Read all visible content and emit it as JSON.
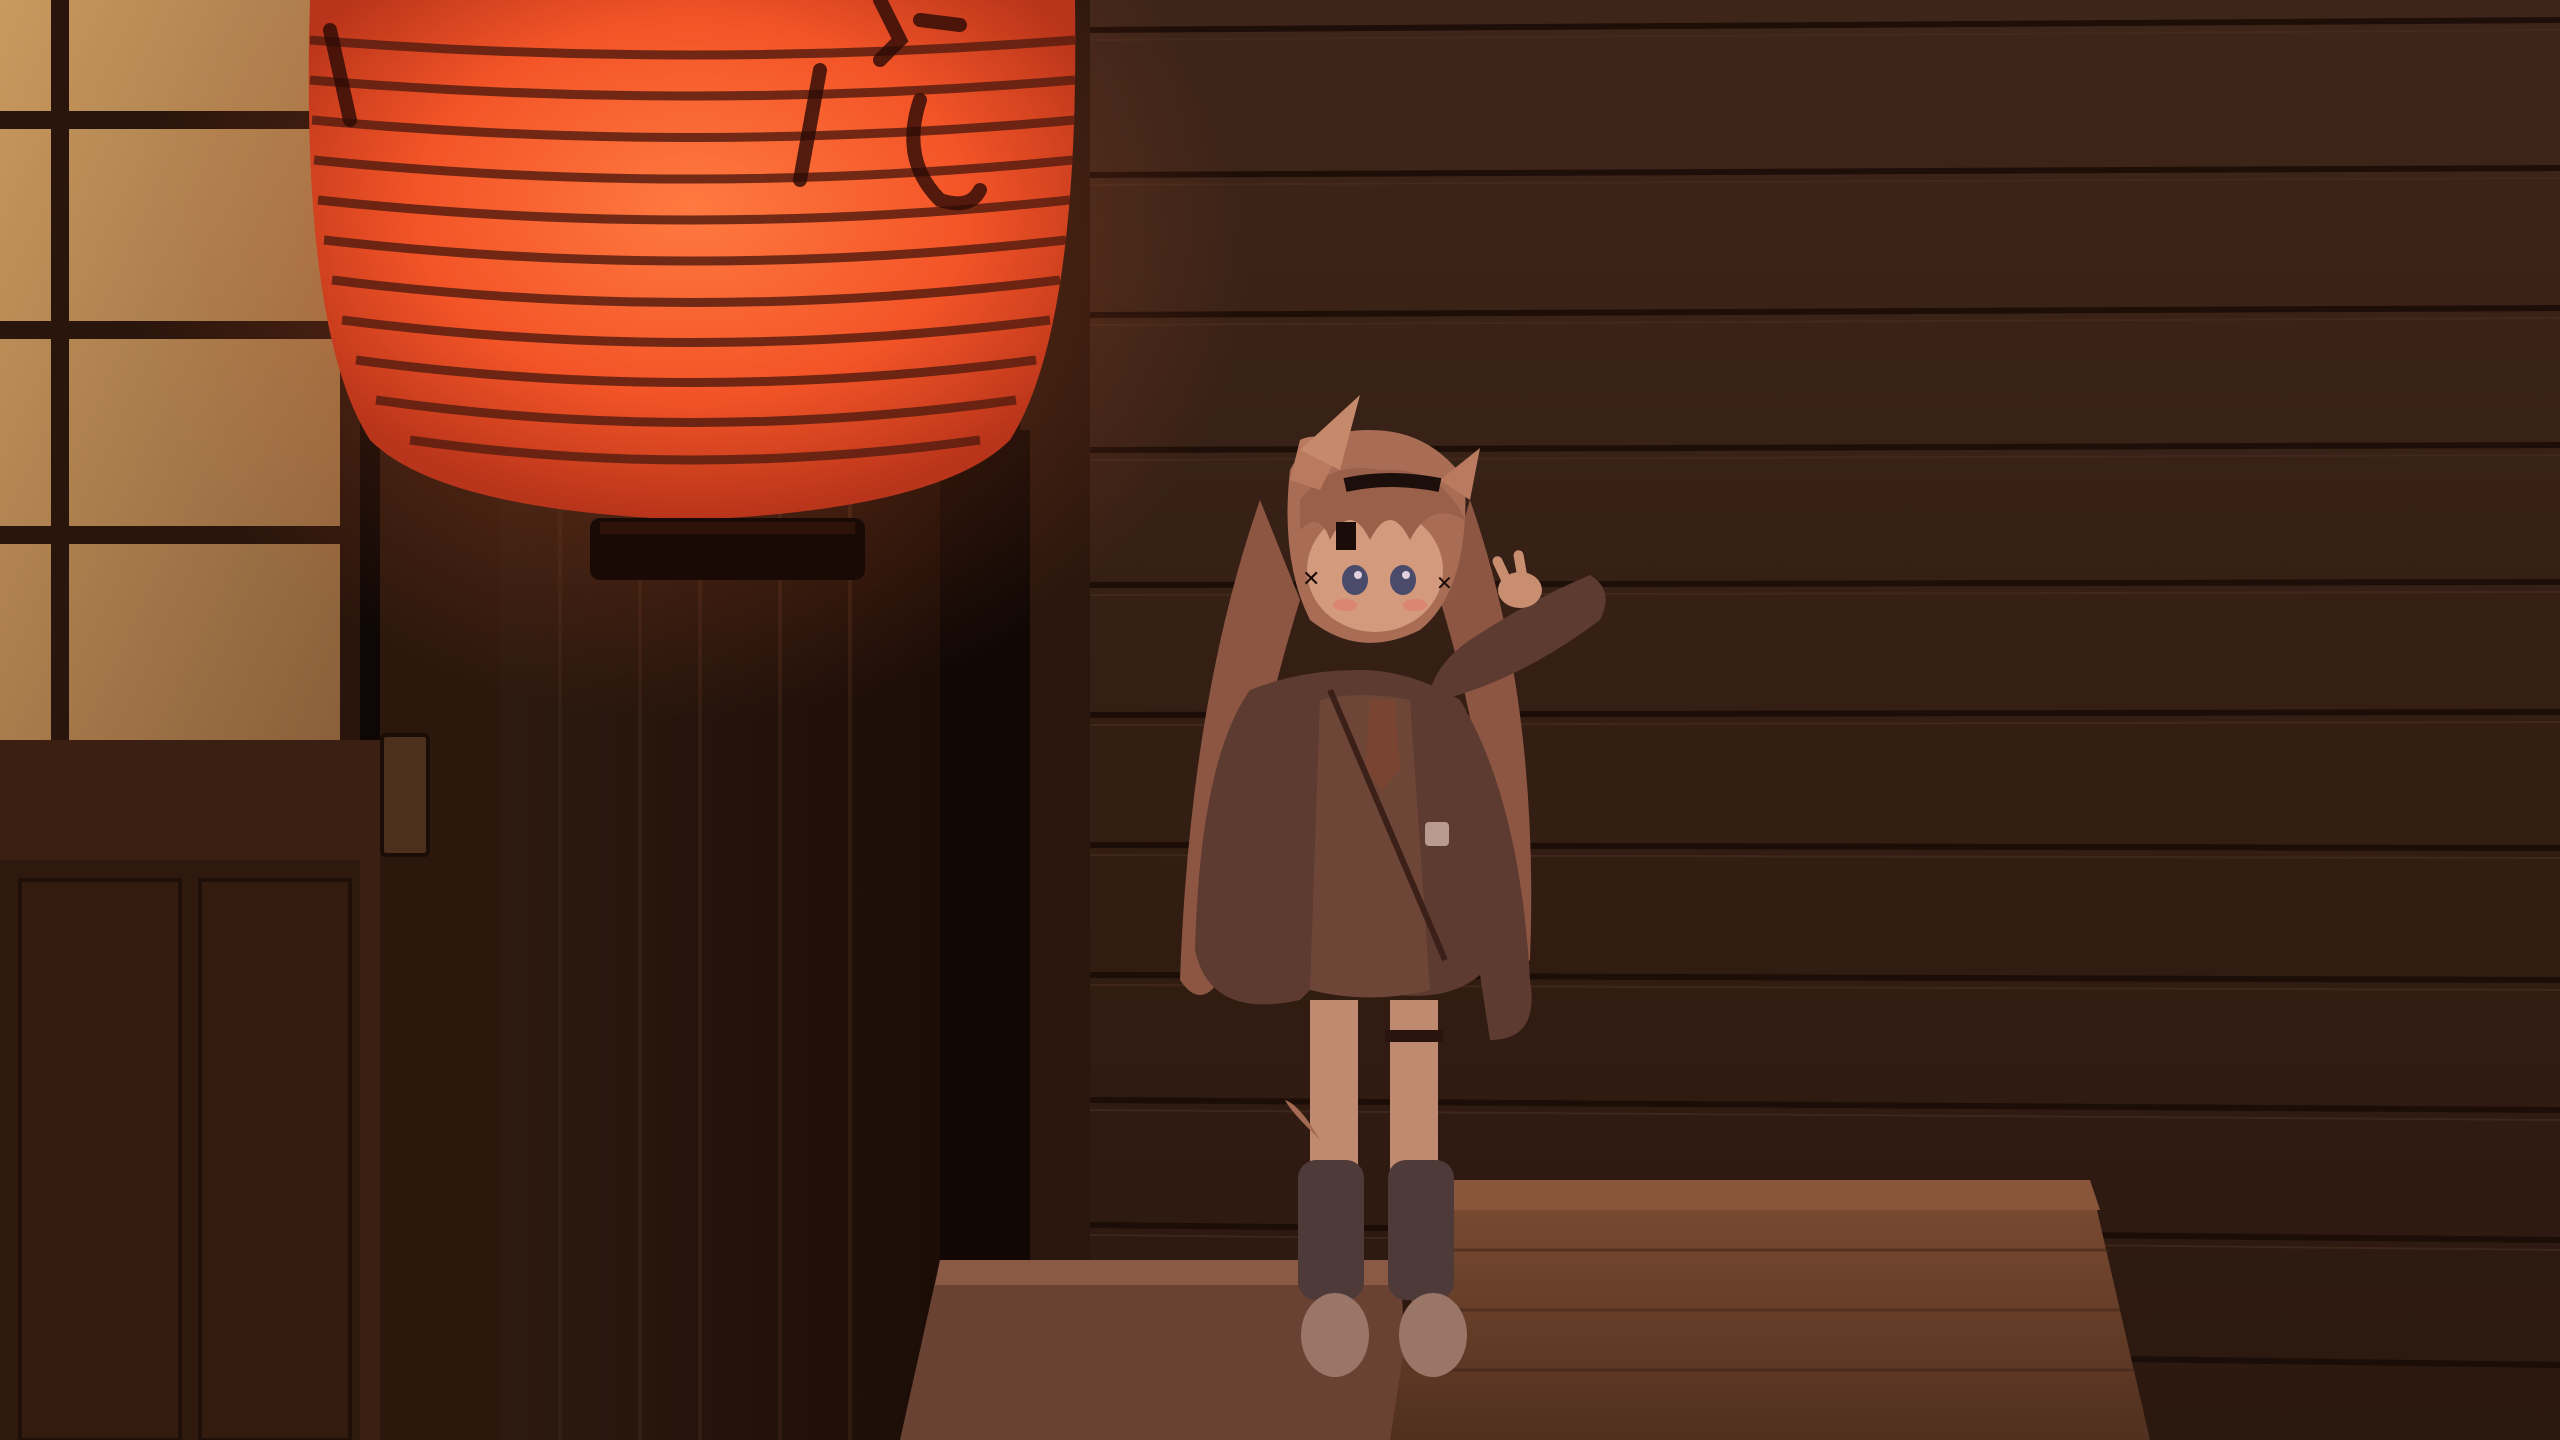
{
  "scene": {
    "palette": {
      "wall": "#3b241a",
      "wall_dark": "#24130c",
      "wall_line": "#1a0c07",
      "lantern": "#ff5a2a",
      "lantern_glow": "#ff7a3a",
      "window_light": "#b8864f",
      "door": "#2a160e",
      "character_skin": "#d79c7c",
      "character_hair": "#a66c52",
      "jacket": "#5b3a30",
      "crate": "#7a4a32"
    },
    "elements": [
      "shoji-window",
      "sliding-door",
      "paper-lantern",
      "wooden-wall",
      "wooden-crate",
      "stone-step",
      "avatar-character"
    ]
  }
}
